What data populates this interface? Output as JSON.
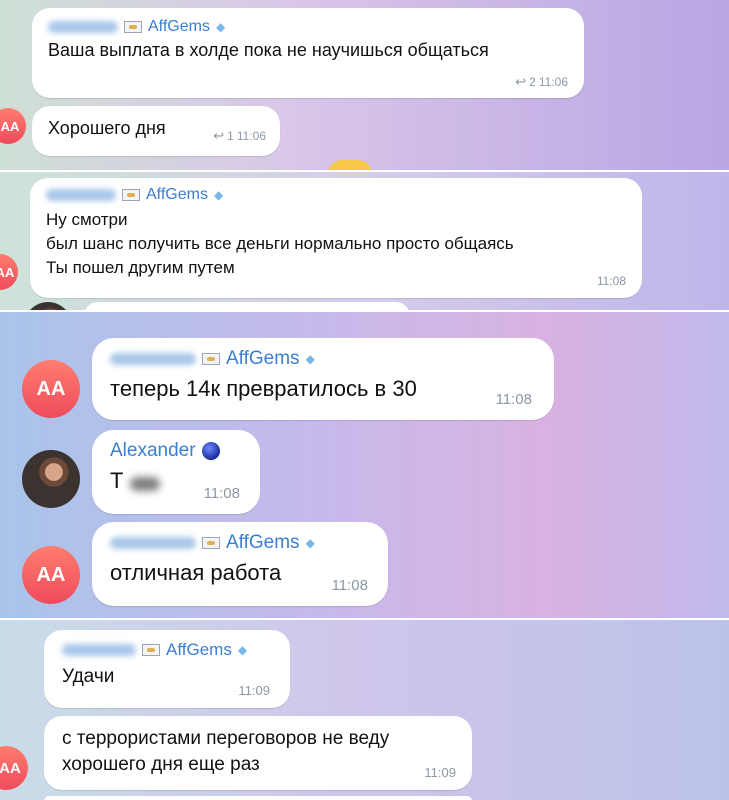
{
  "channel_tag": "AffGems",
  "messages": [
    {
      "text": "Ваша выплата в холде пока не научишься общаться",
      "replies": "2",
      "time": "11:06"
    },
    {
      "text": "Хорошего дня",
      "replies": "1",
      "time": "11:06"
    },
    {
      "text": "Ну смотри\nбыл шанс получить все деньги нормально просто общаясь\nТы пошел другим путем",
      "time": "11:08"
    },
    {
      "text": "теперь 14к превратилось в 30",
      "time": "11:08"
    },
    {
      "sender": "Alexander",
      "text": "Т",
      "time": "11:08"
    },
    {
      "text": "отличная работа",
      "time": "11:08"
    },
    {
      "text": "Удачи",
      "time": "11:09"
    },
    {
      "text": "с террористами переговоров не веду\nхорошего дня еще раз",
      "time": "11:09"
    }
  ],
  "avatar_initials": "AA",
  "colors": {
    "accent": "#3a7fd0",
    "avatar": "#ee4b5c",
    "bubble": "#ffffff",
    "meta": "#8c98a6"
  }
}
